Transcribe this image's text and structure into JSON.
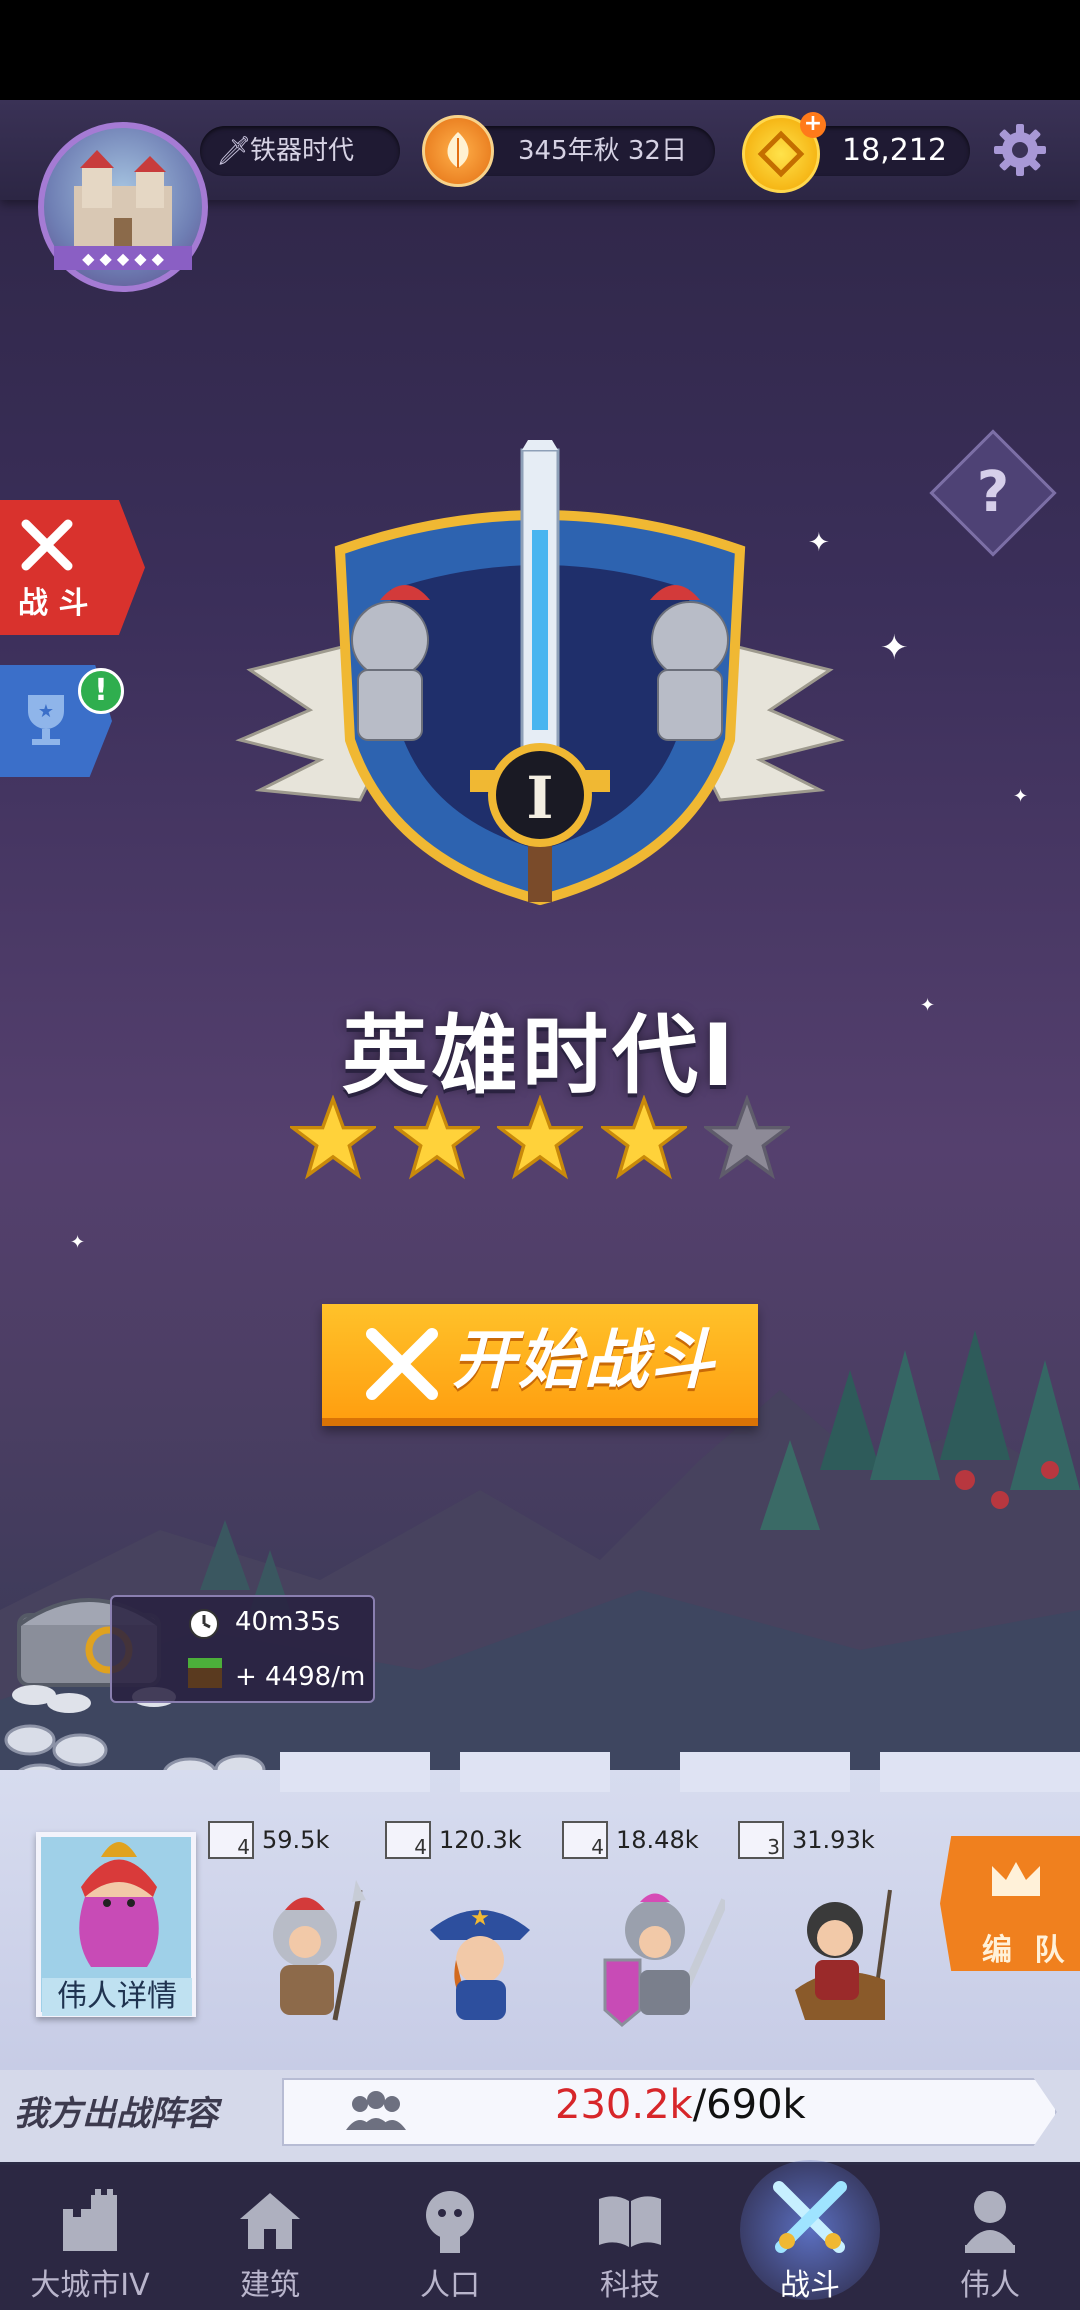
{
  "top_bar": {
    "era_label": "铁器时代",
    "date_label": "345年秋 32日",
    "gold_value": "18,212"
  },
  "side_tabs": {
    "battle_label": "战 斗"
  },
  "rank": {
    "title": "英雄时代I",
    "emblem_numeral": "I",
    "stars_earned": 4,
    "stars_total": 5
  },
  "start_battle": {
    "label": "开始战斗"
  },
  "chest": {
    "timer": "40m35s",
    "rate": "+ 4498/m"
  },
  "hero": {
    "detail_label": "伟人详情"
  },
  "units": [
    {
      "level": "4",
      "power": "59.5k"
    },
    {
      "level": "4",
      "power": "120.3k"
    },
    {
      "level": "4",
      "power": "18.48k"
    },
    {
      "level": "3",
      "power": "31.93k"
    }
  ],
  "formation": {
    "label": "编 队"
  },
  "lineup": {
    "label": "我方出战阵容",
    "current_power": "230.2k",
    "max_power": "/690k"
  },
  "nav": {
    "items": [
      {
        "label": "大城市IV",
        "icon": "castle-icon"
      },
      {
        "label": "建筑",
        "icon": "house-icon"
      },
      {
        "label": "人口",
        "icon": "person-head-icon"
      },
      {
        "label": "科技",
        "icon": "book-icon"
      },
      {
        "label": "战斗",
        "icon": "crossed-swords-icon",
        "active": true
      },
      {
        "label": "伟人",
        "icon": "bust-icon"
      }
    ]
  },
  "colors": {
    "accent_orange": "#ffb21f",
    "battle_red": "#d9322d",
    "trophy_blue": "#3b6fc9",
    "star_gold": "#ffd23a",
    "power_red": "#d7262a"
  }
}
